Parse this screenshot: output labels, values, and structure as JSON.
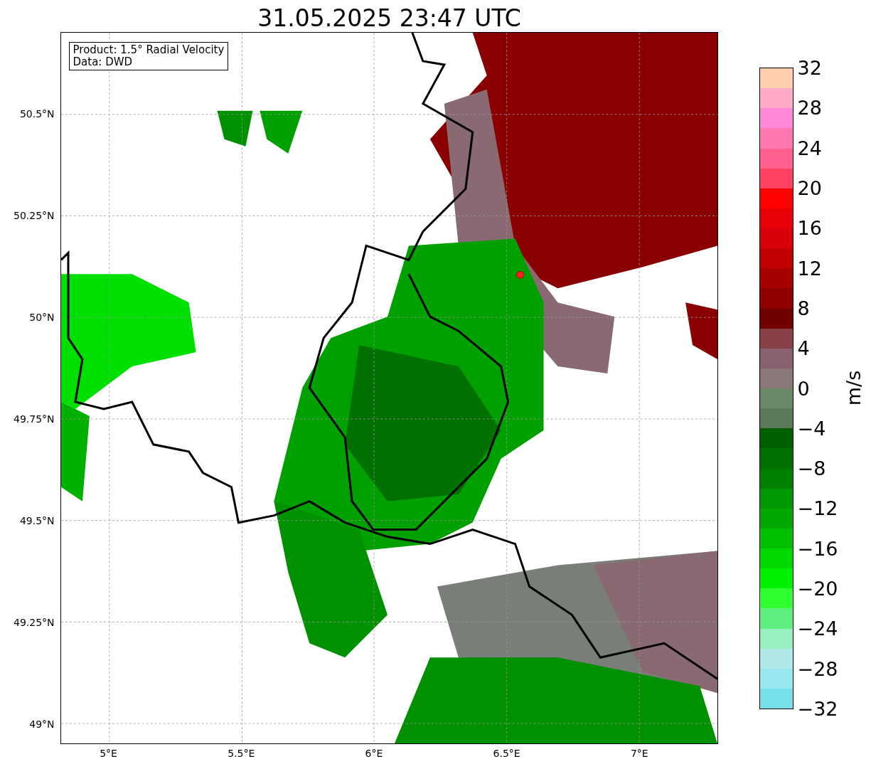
{
  "title": "31.05.2025 23:47 UTC",
  "map": {
    "legend_lines": [
      "Product: 1.5° Radial Velocity",
      "Data: DWD"
    ],
    "yticks": [
      "50.5°N",
      "50.25°N",
      "50°N",
      "49.75°N",
      "49.5°N",
      "49.25°N",
      "49°N"
    ],
    "xticks": [
      "5°E",
      "5.5°E",
      "6°E",
      "6.5°E",
      "7°E"
    ]
  },
  "colorbar": {
    "label": "m/s",
    "ticks": [
      "32",
      "28",
      "24",
      "20",
      "16",
      "12",
      "8",
      "4",
      "0",
      "−4",
      "−8",
      "−12",
      "−16",
      "−20",
      "−24",
      "−28",
      "−32"
    ],
    "segments": [
      {
        "color": "#ffd0b0"
      },
      {
        "color": "#ffaac8"
      },
      {
        "color": "#ff88d8"
      },
      {
        "color": "#ff78b0"
      },
      {
        "color": "#ff6090"
      },
      {
        "color": "#ff4060"
      },
      {
        "color": "#ff0000"
      },
      {
        "color": "#e80008"
      },
      {
        "color": "#d80008"
      },
      {
        "color": "#c00000"
      },
      {
        "color": "#a80000"
      },
      {
        "color": "#900000"
      },
      {
        "color": "#700000"
      },
      {
        "color": "#884048"
      },
      {
        "color": "#886070"
      },
      {
        "color": "#887878"
      },
      {
        "color": "#688868"
      },
      {
        "color": "#5a7a5a"
      },
      {
        "color": "#006000"
      },
      {
        "color": "#007000"
      },
      {
        "color": "#008000"
      },
      {
        "color": "#009800"
      },
      {
        "color": "#00a800"
      },
      {
        "color": "#00c000"
      },
      {
        "color": "#00d800"
      },
      {
        "color": "#00f000"
      },
      {
        "color": "#30ff30"
      },
      {
        "color": "#60f080"
      },
      {
        "color": "#98f0c0"
      },
      {
        "color": "#b0e8e8"
      },
      {
        "color": "#98e8f0"
      },
      {
        "color": "#78e0e8"
      }
    ]
  }
}
